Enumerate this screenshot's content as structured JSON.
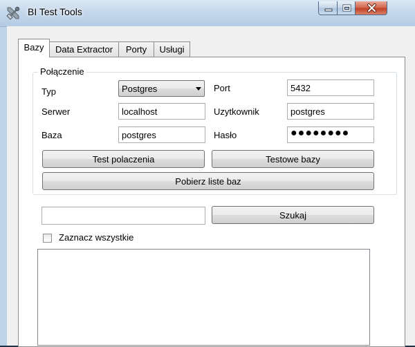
{
  "window": {
    "title": "BI Test Tools",
    "app_icon": "tools-icon",
    "controls": [
      "minimize-icon",
      "maximize-icon",
      "close-icon"
    ]
  },
  "tabs": [
    {
      "label": "Bazy",
      "active": true
    },
    {
      "label": "Data Extractor",
      "active": false
    },
    {
      "label": "Porty",
      "active": false
    },
    {
      "label": "Usługi",
      "active": false
    }
  ],
  "connection": {
    "group_label": "Połączenie",
    "type_label": "Typ",
    "type_value": "Postgres",
    "port_label": "Port",
    "port_value": "5432",
    "server_label": "Serwer",
    "server_value": "localhost",
    "user_label": "Uzytkownik",
    "user_value": "postgres",
    "db_label": "Baza",
    "db_value": "postgres",
    "password_label": "Hasło",
    "password_value": "●●●●●●●●",
    "test_connection_button": "Test polaczenia",
    "test_databases_button": "Testowe bazy",
    "fetch_list_button": "Pobierz liste baz"
  },
  "search": {
    "input_value": "",
    "search_button": "Szukaj",
    "select_all_label": "Zaznacz wszystkie",
    "select_all_checked": false
  },
  "colors": {
    "titlebar": "#c5d8ec",
    "close_button": "#c04226",
    "panel_background": "#f0f0f0"
  }
}
